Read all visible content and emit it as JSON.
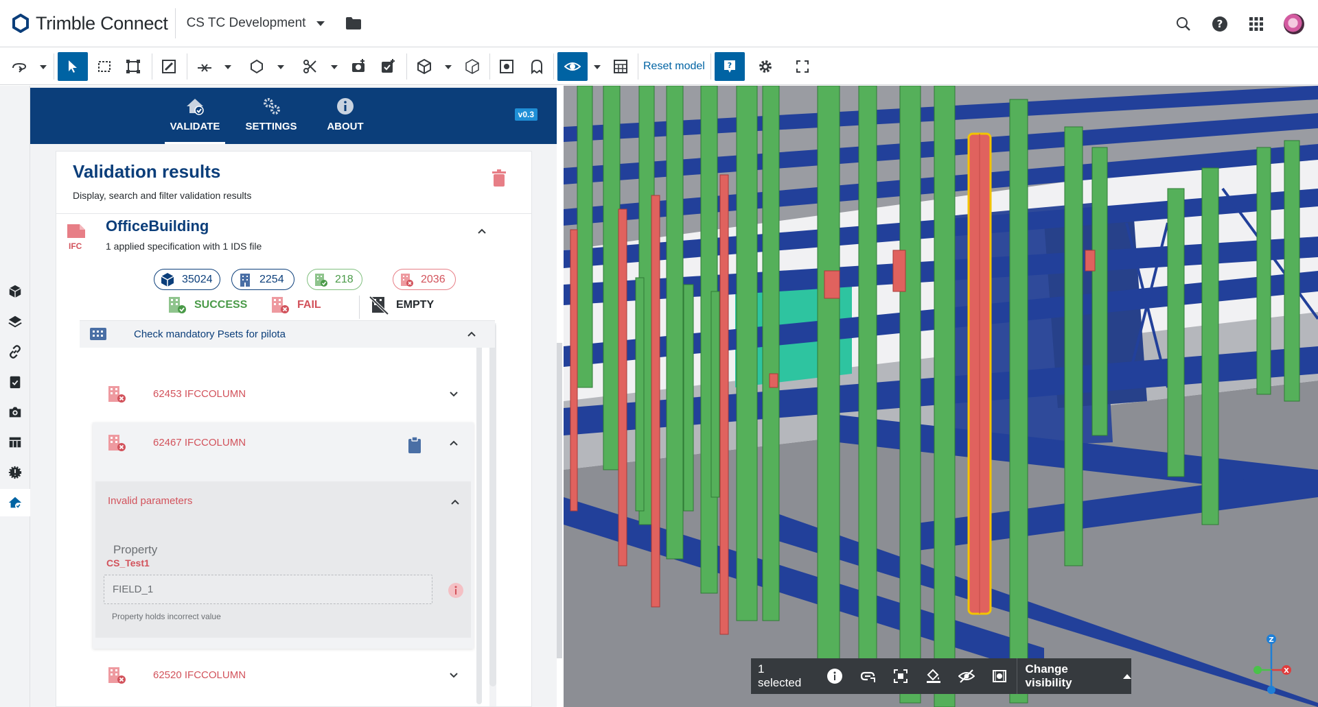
{
  "header": {
    "brand": "Trimble Connect",
    "project": "CS TC Development"
  },
  "toolbar": {
    "reset_label": "Reset model"
  },
  "extension": {
    "tabs": [
      {
        "label": "VALIDATE",
        "active": true
      },
      {
        "label": "SETTINGS",
        "active": false
      },
      {
        "label": "ABOUT",
        "active": false
      }
    ],
    "version": "v0.3"
  },
  "results": {
    "title": "Validation results",
    "subtitle": "Display, search and filter validation results",
    "file": {
      "name": "OfficeBuilding",
      "ifc_label": "IFC",
      "description": "1 applied specification with 1 IDS file"
    },
    "counts": {
      "total_objects": "35024",
      "checked": "2254",
      "success": "218",
      "fail": "2036"
    },
    "legend": {
      "success": "SUCCESS",
      "fail": "FAIL",
      "empty": "EMPTY"
    },
    "group": {
      "label": "Check mandatory Psets for pilota"
    },
    "items": [
      {
        "label": "62453 IFCCOLUMN",
        "expanded": false
      },
      {
        "label": "62467 IFCCOLUMN",
        "expanded": true
      },
      {
        "label": "62520 IFCCOLUMN",
        "expanded": false
      }
    ],
    "detail": {
      "section_title": "Invalid parameters",
      "property_label": "Property",
      "property_name": "CS_Test1",
      "field_value": "FIELD_1",
      "help_text": "Property holds incorrect value"
    }
  },
  "viewer": {
    "selected_text": "1 selected",
    "visibility_label": "Change visibility",
    "axes": {
      "z": "Z",
      "x": "X"
    }
  },
  "colors": {
    "brand_blue": "#0b3e7a",
    "accent_blue": "#0063a3",
    "fail_red": "#d2525b",
    "success_green": "#4a9a48"
  }
}
